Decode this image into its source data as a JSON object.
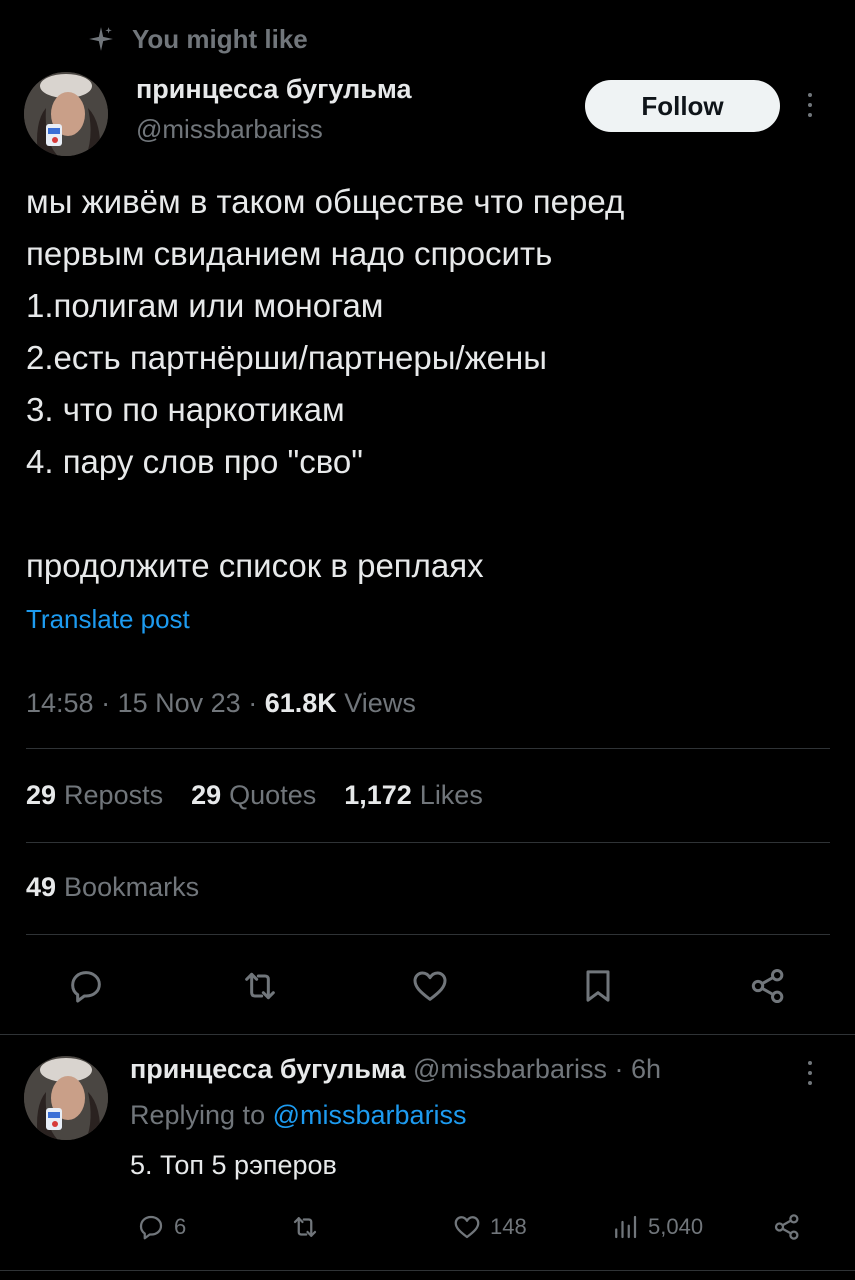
{
  "context": {
    "label": "You might like",
    "icon": "sparkle-icon"
  },
  "post": {
    "author_name": "принцесса бугульма",
    "author_handle": "@missbarbariss",
    "follow_label": "Follow",
    "text_lines": [
      "мы живём в таком обществе что перед",
      "первым свиданием надо спросить",
      "1.полигам или моногам",
      "2.есть партнёрши/партнеры/жены",
      "3. что по наркотикам",
      "4. пару слов про \"сво\"",
      "",
      "продолжите список в реплаях"
    ],
    "translate_label": "Translate post",
    "time": "14:58",
    "date": "15 Nov 23",
    "views_count": "61.8K",
    "views_label": "Views",
    "reposts_count": "29",
    "reposts_label": "Reposts",
    "quotes_count": "29",
    "quotes_label": "Quotes",
    "likes_count": "1,172",
    "likes_label": "Likes",
    "bookmarks_count": "49",
    "bookmarks_label": "Bookmarks",
    "actions": [
      "reply-icon",
      "repost-icon",
      "like-icon",
      "bookmark-icon",
      "share-icon"
    ]
  },
  "reply": {
    "author_name": "принцесса бугульма",
    "author_handle": "@missbarbariss",
    "time_ago": "6h",
    "replying_to_label": "Replying to",
    "replying_to_handle": "@missbarbariss",
    "text": "5. Топ 5 рэперов",
    "reply_count": "6",
    "like_count": "148",
    "view_count": "5,040"
  },
  "colors": {
    "background": "#000000",
    "text": "#e7e9ea",
    "secondary": "#71767b",
    "accent": "#1d9bf0",
    "divider": "#2f3336"
  }
}
